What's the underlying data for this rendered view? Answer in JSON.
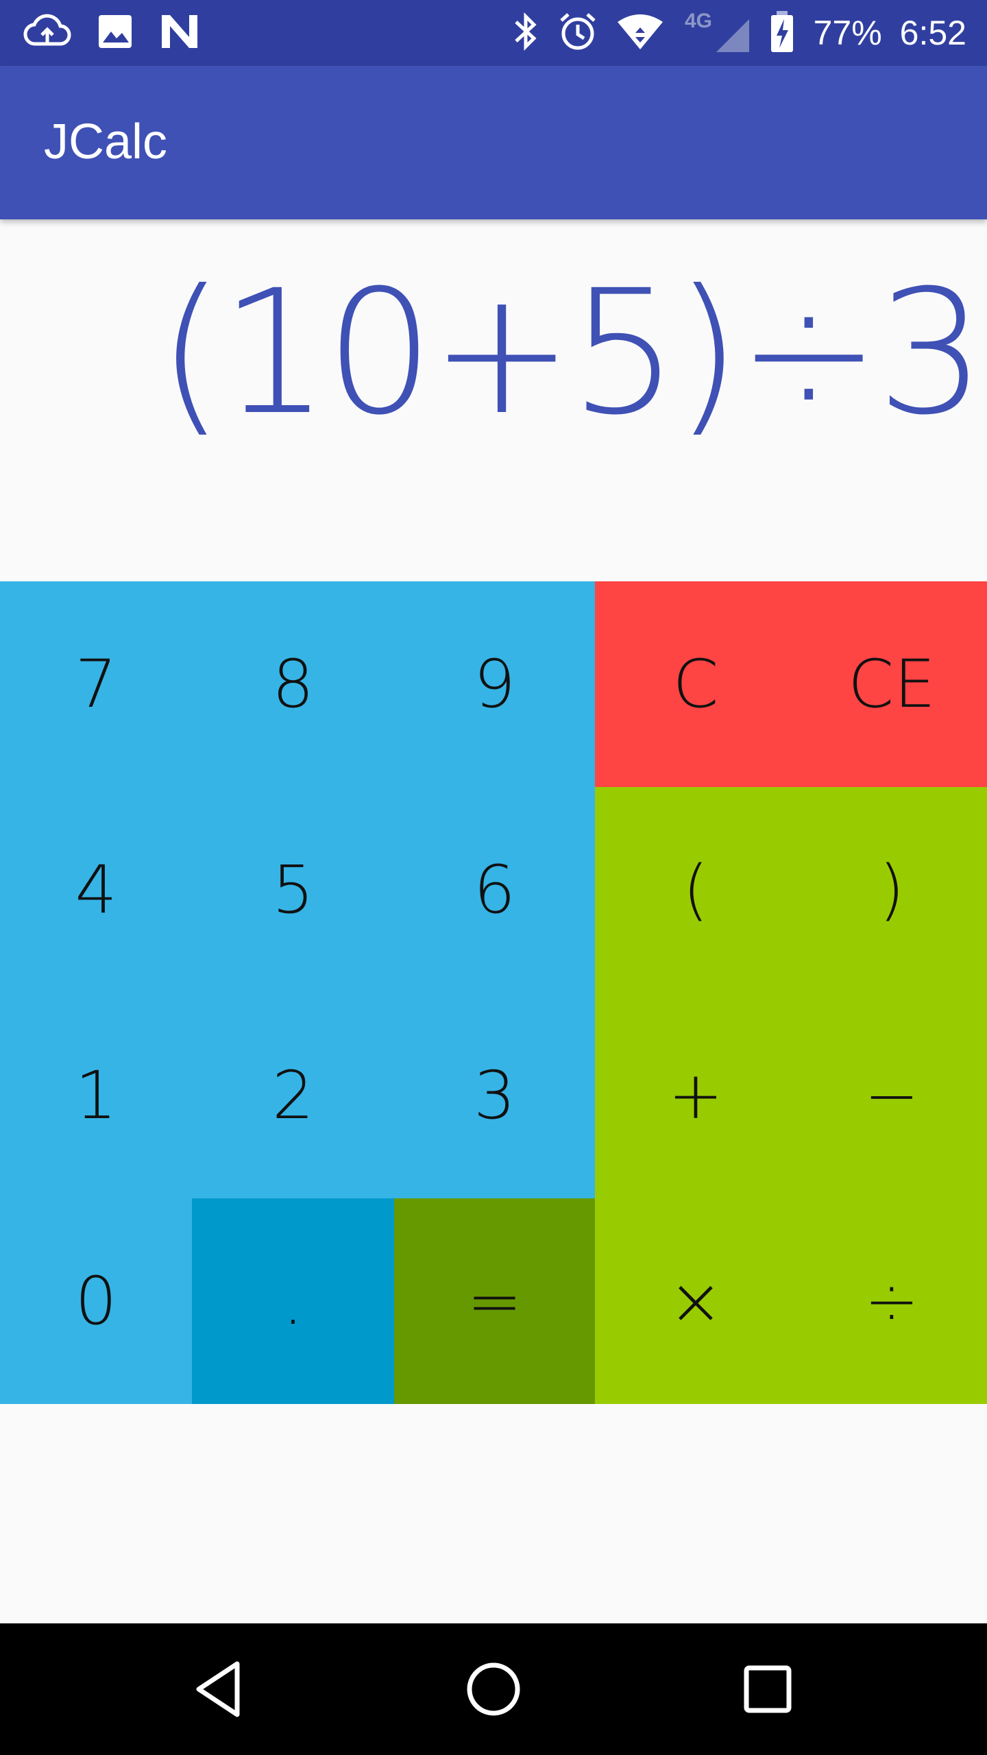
{
  "status_bar": {
    "battery": "77%",
    "time": "6:52",
    "network": "4G LTE",
    "icons_left": [
      "cloud-upload-icon",
      "image-icon",
      "n-icon"
    ],
    "icons_right": [
      "bluetooth-icon",
      "alarm-icon",
      "wifi-icon",
      "signal-icon",
      "battery-charging-icon"
    ]
  },
  "app_bar": {
    "title": "JCalc"
  },
  "display": {
    "expression": "(10+5)÷3"
  },
  "keypad": {
    "colors": {
      "digits": "#36b4e6",
      "dot": "#0099cc",
      "equals": "#669900",
      "clear": "#ff4444",
      "operators": "#99cc00"
    },
    "keys": {
      "seven": "7",
      "eight": "8",
      "nine": "9",
      "clear": "C",
      "clear_entry": "CE",
      "four": "4",
      "five": "5",
      "six": "6",
      "open_paren": "(",
      "close_paren": ")",
      "one": "1",
      "two": "2",
      "three": "3",
      "plus": "+",
      "minus": "−",
      "zero": "0",
      "dot": ".",
      "equals": "=",
      "multiply": "×",
      "divide": "÷"
    }
  },
  "nav_bar": {
    "buttons": [
      "back-icon",
      "home-icon",
      "recents-icon"
    ]
  }
}
